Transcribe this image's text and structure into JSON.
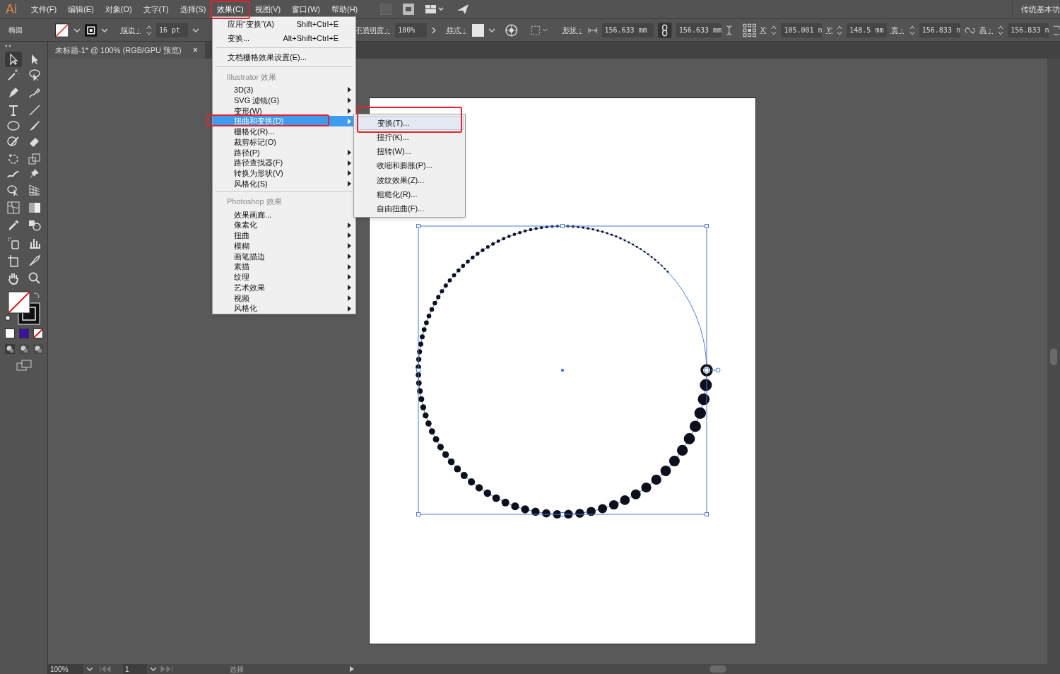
{
  "menu_bar": {
    "logo": "Ai",
    "items": [
      {
        "label": "文件(F)",
        "selected": false
      },
      {
        "label": "编辑(E)",
        "selected": false
      },
      {
        "label": "对象(O)",
        "selected": false
      },
      {
        "label": "文字(T)",
        "selected": false
      },
      {
        "label": "选择(S)",
        "selected": false
      },
      {
        "label": "效果(C)",
        "selected": true
      },
      {
        "label": "视图(V)",
        "selected": false
      },
      {
        "label": "窗口(W)",
        "selected": false
      },
      {
        "label": "帮助(H)",
        "selected": false
      }
    ],
    "workspace": "传统基本功"
  },
  "control_bar": {
    "object_type": "椭圆",
    "stroke_label": "描边：",
    "stroke_value": "16 pt",
    "opacity_label": "不透明度：",
    "opacity_value": "100%",
    "style_label": "样式：",
    "shape_label": "形状：",
    "shape_width": "156.633 mm",
    "shape_height": "156.633 mm",
    "x_label": "X:",
    "x_value": "105.001 n",
    "y_label": "Y:",
    "y_value": "148.5 mm",
    "w_label": "宽：",
    "w_value": "156.833 n",
    "h_label": "高：",
    "h_value": "156.833 n"
  },
  "document_tab": {
    "title": "未标题-1* @ 100% (RGB/GPU 预览)",
    "close": "×"
  },
  "effect_menu": {
    "items": [
      {
        "kind": "item",
        "label": "应用“变换”(A)",
        "shortcut": "Shift+Ctrl+E"
      },
      {
        "kind": "item",
        "label": "变换...",
        "shortcut": "Alt+Shift+Ctrl+E"
      },
      {
        "kind": "separator"
      },
      {
        "kind": "item",
        "label": "文档栅格效果设置(E)..."
      },
      {
        "kind": "separator"
      },
      {
        "kind": "header",
        "label": "Illustrator 效果"
      },
      {
        "kind": "entry",
        "label": "3D(3)",
        "submenu": true,
        "selected": false
      },
      {
        "kind": "entry",
        "label": "SVG 滤镜(G)",
        "submenu": true,
        "selected": false
      },
      {
        "kind": "entry",
        "label": "变形(W)",
        "submenu": true,
        "selected": false
      },
      {
        "kind": "entry",
        "label": "扭曲和变换(D)",
        "submenu": true,
        "selected": true
      },
      {
        "kind": "entry",
        "label": "栅格化(R)...",
        "submenu": false,
        "selected": false
      },
      {
        "kind": "entry",
        "label": "裁剪标记(O)",
        "submenu": false,
        "selected": false
      },
      {
        "kind": "entry",
        "label": "路径(P)",
        "submenu": true,
        "selected": false
      },
      {
        "kind": "entry",
        "label": "路径查找器(F)",
        "submenu": true,
        "selected": false
      },
      {
        "kind": "entry",
        "label": "转换为形状(V)",
        "submenu": true,
        "selected": false
      },
      {
        "kind": "entry",
        "label": "风格化(S)",
        "submenu": true,
        "selected": false
      },
      {
        "kind": "separator"
      },
      {
        "kind": "header",
        "label": "Photoshop 效果"
      },
      {
        "kind": "entry",
        "label": "效果画廊...",
        "submenu": false,
        "selected": false
      },
      {
        "kind": "entry",
        "label": "像素化",
        "submenu": true,
        "selected": false
      },
      {
        "kind": "entry",
        "label": "扭曲",
        "submenu": true,
        "selected": false
      },
      {
        "kind": "entry",
        "label": "模糊",
        "submenu": true,
        "selected": false
      },
      {
        "kind": "entry",
        "label": "画笔描边",
        "submenu": true,
        "selected": false
      },
      {
        "kind": "entry",
        "label": "素描",
        "submenu": true,
        "selected": false
      },
      {
        "kind": "entry",
        "label": "纹理",
        "submenu": true,
        "selected": false
      },
      {
        "kind": "entry",
        "label": "艺术效果",
        "submenu": true,
        "selected": false
      },
      {
        "kind": "entry",
        "label": "视频",
        "submenu": true,
        "selected": false
      },
      {
        "kind": "entry",
        "label": "风格化",
        "submenu": true,
        "selected": false
      }
    ]
  },
  "distort_submenu": {
    "items": [
      {
        "label": "变换(T)...",
        "selected": true
      },
      {
        "label": "扭拧(K)...",
        "selected": false
      },
      {
        "label": "扭转(W)...",
        "selected": false
      },
      {
        "label": "收缩和膨胀(P)...",
        "selected": false
      },
      {
        "label": "波纹效果(Z)...",
        "selected": false
      },
      {
        "label": "粗糙化(R)...",
        "selected": false
      },
      {
        "label": "自由扭曲(F)...",
        "selected": false
      }
    ]
  },
  "status_bar": {
    "zoom": "100%",
    "artboard": "1",
    "tool": "选择"
  }
}
